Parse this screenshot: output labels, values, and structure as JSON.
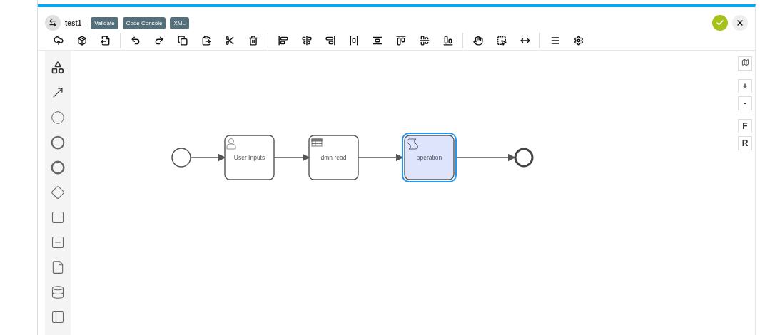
{
  "header": {
    "title": "test1",
    "buttons": [
      "Validate",
      "Code Console",
      "XML"
    ]
  },
  "diagram": {
    "nodes": [
      {
        "kind": "start",
        "selected": false
      },
      {
        "kind": "user-task",
        "label": "User Inputs",
        "selected": false
      },
      {
        "kind": "business-rule-task",
        "label": "dmn read",
        "selected": false
      },
      {
        "kind": "script-task",
        "label": "operation",
        "selected": true
      },
      {
        "kind": "end",
        "selected": false
      }
    ]
  },
  "zoom_controls": [
    "+",
    "-",
    "F",
    "R"
  ]
}
